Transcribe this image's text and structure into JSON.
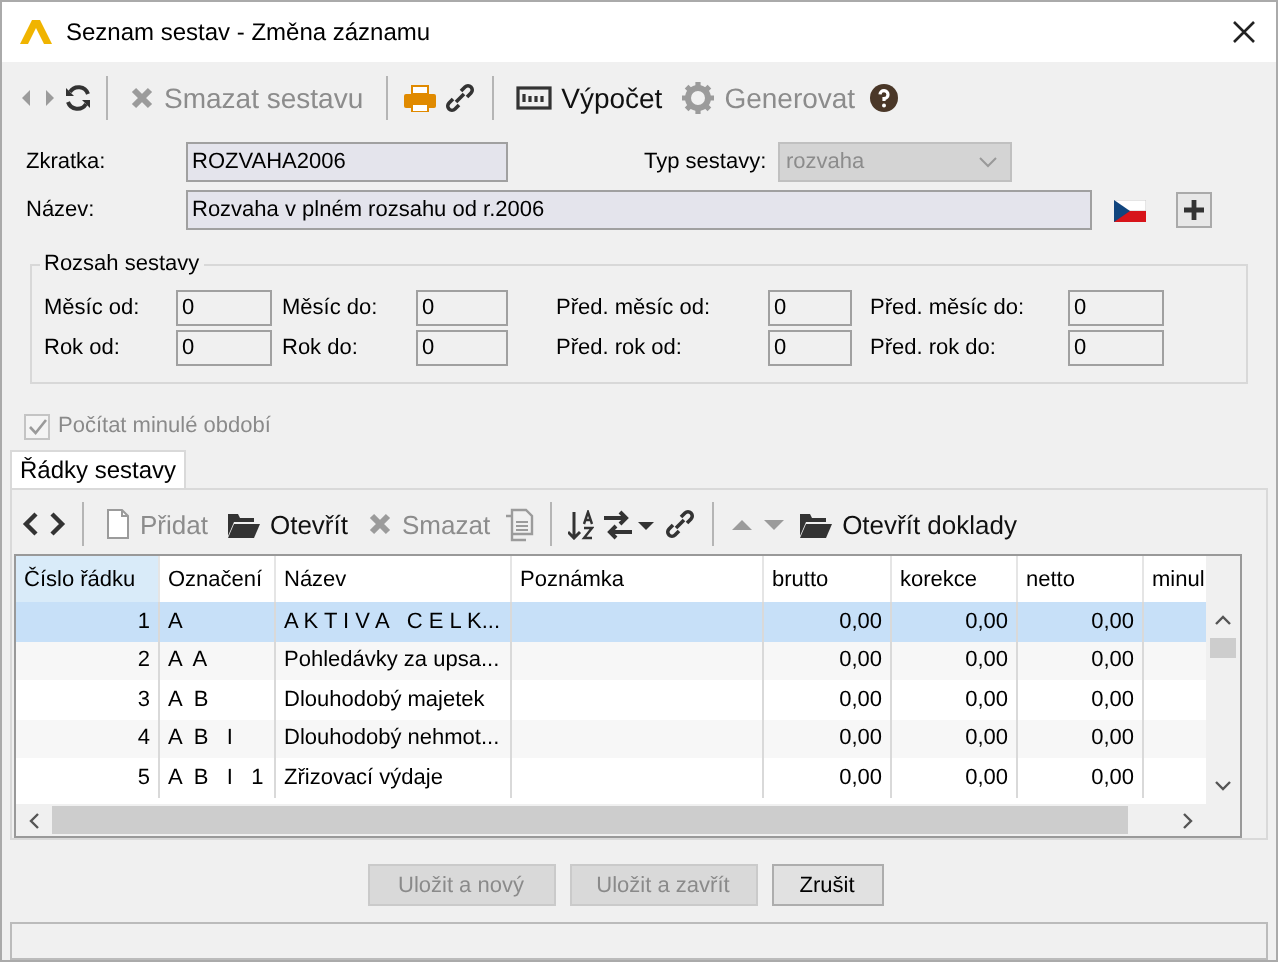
{
  "window": {
    "title": "Seznam sestav - Změna záznamu"
  },
  "toolbar": [
    {
      "kind": "back",
      "disabled": true
    },
    {
      "kind": "forward",
      "disabled": true
    },
    {
      "kind": "refresh",
      "disabled": false
    },
    {
      "kind": "separator"
    },
    {
      "kind": "delete",
      "label": "Smazat sestavu",
      "disabled": true
    },
    {
      "kind": "separator"
    },
    {
      "kind": "print",
      "disabled": false
    },
    {
      "kind": "link",
      "disabled": false
    },
    {
      "kind": "separator"
    },
    {
      "kind": "calc",
      "label": "Výpočet",
      "disabled": false
    },
    {
      "kind": "gear",
      "label": "Generovat",
      "disabled": true
    },
    {
      "kind": "help"
    }
  ],
  "form": {
    "zkratka": {
      "label": "Zkratka:",
      "value": "ROZVAHA2006"
    },
    "typ": {
      "label": "Typ sestavy:",
      "value": "rozvaha",
      "disabled": true
    },
    "nazev": {
      "label": "Název:",
      "value": "Rozvaha v plném rozsahu od r.2006"
    }
  },
  "range": {
    "title": "Rozsah sestavy",
    "fields": [
      {
        "label": "Měsíc od:",
        "value": "0"
      },
      {
        "label": "Měsíc do:",
        "value": "0"
      },
      {
        "label": "Před. měsíc od:",
        "value": "0"
      },
      {
        "label": "Před. měsíc do:",
        "value": "0"
      },
      {
        "label": "Rok od:",
        "value": "0"
      },
      {
        "label": "Rok do:",
        "value": "0"
      },
      {
        "label": "Před. rok od:",
        "value": "0"
      },
      {
        "label": "Před. rok do:",
        "value": "0"
      }
    ]
  },
  "checkbox": {
    "label": "Počítat minulé období",
    "checked": true,
    "disabled": true
  },
  "tabs": [
    {
      "label": "Řádky sestavy",
      "selected": true
    }
  ],
  "grid_toolbar": [
    {
      "kind": "prev",
      "disabled": false
    },
    {
      "kind": "next",
      "disabled": false
    },
    {
      "kind": "separator"
    },
    {
      "kind": "new",
      "label": "Přidat",
      "disabled": true
    },
    {
      "kind": "open",
      "label": "Otevřít",
      "disabled": false
    },
    {
      "kind": "delete",
      "label": "Smazat",
      "disabled": true
    },
    {
      "kind": "copy",
      "disabled": true
    },
    {
      "kind": "separator"
    },
    {
      "kind": "sort",
      "disabled": false
    },
    {
      "kind": "swap",
      "disabled": false
    },
    {
      "kind": "link",
      "disabled": false
    },
    {
      "kind": "separator"
    },
    {
      "kind": "up",
      "disabled": true
    },
    {
      "kind": "down",
      "disabled": true
    },
    {
      "kind": "open",
      "label": "Otevřít doklady",
      "disabled": false
    }
  ],
  "table": {
    "columns": [
      {
        "label": "Číslo řádku",
        "kind": "number",
        "sorted": true
      },
      {
        "label": "Označení",
        "kind": "code",
        "sorted": false
      },
      {
        "label": "Název",
        "kind": "text",
        "sorted": false
      },
      {
        "label": "Poznámka",
        "kind": "text",
        "sorted": false
      },
      {
        "label": "brutto",
        "kind": "number",
        "sorted": false
      },
      {
        "label": "korekce",
        "kind": "number",
        "sorted": false
      },
      {
        "label": "netto",
        "kind": "number",
        "sorted": false
      },
      {
        "label": "minul",
        "kind": "number",
        "sorted": false
      }
    ],
    "rows": [
      {
        "selected": true,
        "cells": [
          "1",
          "A",
          "A K T I V A   C E L K...",
          "",
          "0,00",
          "0,00",
          "0,00",
          ""
        ]
      },
      {
        "selected": false,
        "cells": [
          "2",
          "A  A",
          "Pohledávky za upsa...",
          "",
          "0,00",
          "0,00",
          "0,00",
          ""
        ]
      },
      {
        "selected": false,
        "cells": [
          "3",
          "A  B",
          "Dlouhodobý majetek",
          "",
          "0,00",
          "0,00",
          "0,00",
          ""
        ]
      },
      {
        "selected": false,
        "cells": [
          "4",
          "A  B   I",
          "Dlouhodobý nehmot...",
          "",
          "0,00",
          "0,00",
          "0,00",
          ""
        ]
      },
      {
        "selected": false,
        "cells": [
          "5",
          "A  B   I   1",
          "Zřizovací výdaje",
          "",
          "0,00",
          "0,00",
          "0,00",
          ""
        ]
      }
    ]
  },
  "buttons": [
    {
      "label": "Uložit a nový",
      "disabled": true
    },
    {
      "label": "Uložit a zavřít",
      "disabled": true
    },
    {
      "label": "Zrušit",
      "disabled": false
    }
  ]
}
